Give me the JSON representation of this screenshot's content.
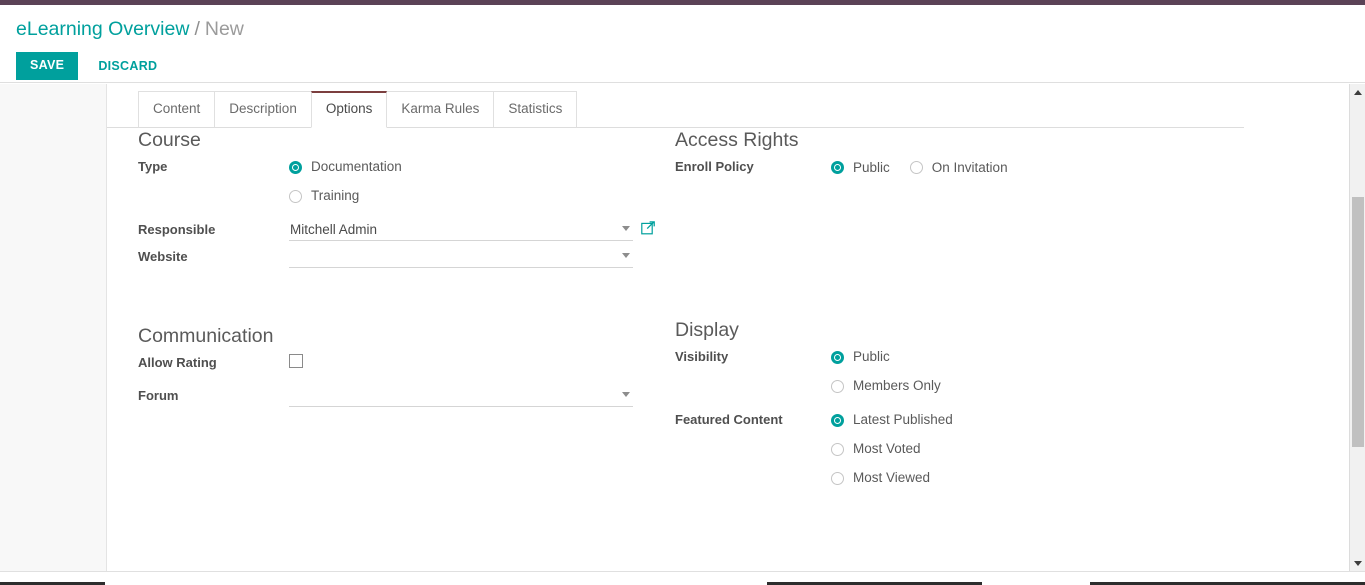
{
  "theme": {
    "accent": "#00A09D",
    "topbar": "#5b4256",
    "active_tab_border": "#7c3f3f",
    "label_color": "#4f4f4f",
    "value_color": "#5a5a5a"
  },
  "control_panel": {
    "breadcrumb": {
      "root": "eLearning Overview",
      "separator": "/",
      "current": "New"
    },
    "save_label": "SAVE",
    "discard_label": "DISCARD"
  },
  "notebook": {
    "tabs": [
      {
        "label": "Content",
        "active": false
      },
      {
        "label": "Description",
        "active": false
      },
      {
        "label": "Options",
        "active": true
      },
      {
        "label": "Karma Rules",
        "active": false
      },
      {
        "label": "Statistics",
        "active": false
      }
    ]
  },
  "form": {
    "course": {
      "title": "Course",
      "type_label": "Type",
      "type_options": [
        {
          "label": "Documentation",
          "selected": true
        },
        {
          "label": "Training",
          "selected": false
        }
      ],
      "responsible_label": "Responsible",
      "responsible_value": "Mitchell Admin",
      "responsible_placeholder": "",
      "website_label": "Website",
      "website_value": "",
      "website_placeholder": ""
    },
    "access_rights": {
      "title": "Access Rights",
      "enroll_policy_label": "Enroll Policy",
      "enroll_policy_options": [
        {
          "label": "Public",
          "selected": true
        },
        {
          "label": "On Invitation",
          "selected": false
        }
      ]
    },
    "communication": {
      "title": "Communication",
      "allow_rating_label": "Allow Rating",
      "allow_rating_checked": false,
      "forum_label": "Forum",
      "forum_value": "",
      "forum_placeholder": ""
    },
    "display": {
      "title": "Display",
      "visibility_label": "Visibility",
      "visibility_options": [
        {
          "label": "Public",
          "selected": true
        },
        {
          "label": "Members Only",
          "selected": false
        }
      ],
      "featured_content_label": "Featured Content",
      "featured_content_options": [
        {
          "label": "Latest Published",
          "selected": true
        },
        {
          "label": "Most Voted",
          "selected": false
        },
        {
          "label": "Most Viewed",
          "selected": false
        }
      ]
    }
  },
  "icons": {
    "external_link": "external-link-icon",
    "dropdown_caret": "chevron-down-icon",
    "scroll_up": "scroll-up-arrow-icon",
    "scroll_down": "scroll-down-arrow-icon"
  }
}
